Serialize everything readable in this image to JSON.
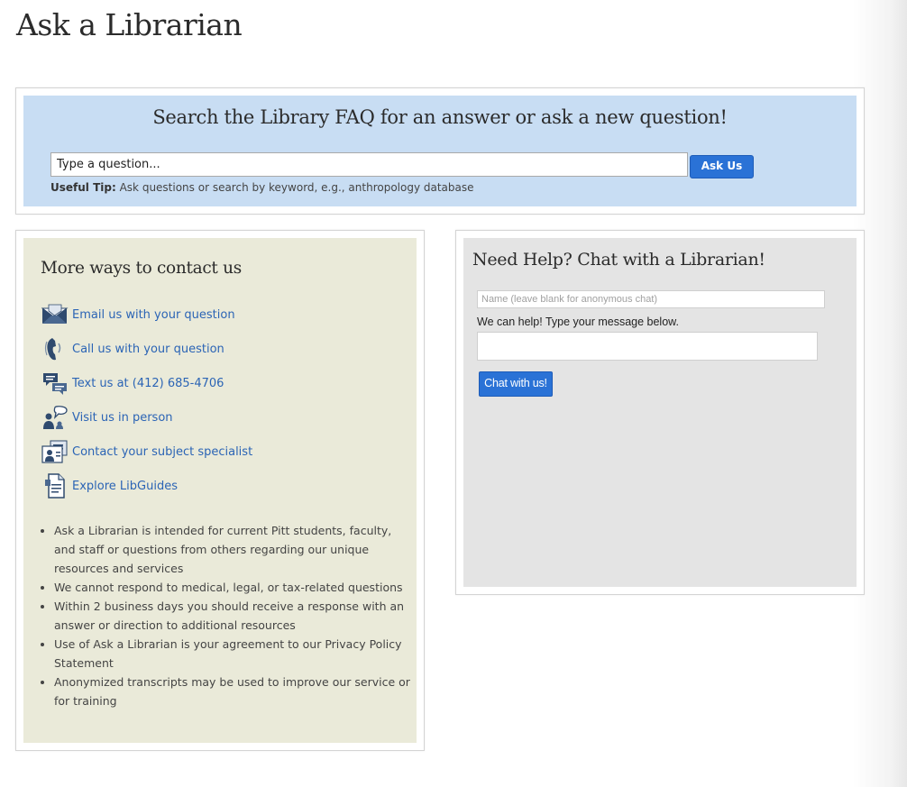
{
  "page": {
    "title": "Ask a Librarian"
  },
  "search": {
    "heading": "Search the Library FAQ for an answer or ask a new question!",
    "placeholder": "Type a question...",
    "button_label": "Ask Us",
    "tip_label": "Useful Tip:",
    "tip_text": " Ask questions or search by keyword, e.g., anthropology database"
  },
  "contact": {
    "heading": "More ways to contact us",
    "items": [
      {
        "label": "Email us with your question",
        "icon": "envelope-icon"
      },
      {
        "label": "Call us with your question",
        "icon": "phone-icon"
      },
      {
        "label": "Text us at (412) 685-4706",
        "icon": "text-message-icon"
      },
      {
        "label": "Visit us in person",
        "icon": "visit-person-icon"
      },
      {
        "label": "Contact your subject specialist",
        "icon": "subject-specialist-icon"
      },
      {
        "label": "Explore LibGuides",
        "icon": "libguides-document-icon"
      }
    ],
    "notes": [
      "Ask a Librarian is intended for current Pitt students, faculty, and staff or questions from others regarding our unique resources and services",
      "We cannot respond to medical, legal, or tax-related questions",
      "Within 2 business days you should receive a response with an answer or direction to additional resources",
      "Use of Ask a Librarian is your agreement to our Privacy Policy Statement",
      "Anonymized transcripts may be used to improve our service or for training"
    ]
  },
  "chat": {
    "heading": "Need Help? Chat with a Librarian!",
    "name_placeholder": "Name (leave blank for anonymous chat)",
    "help_text": "We can help! Type your message below.",
    "message_value": "",
    "button_label": "Chat with us!"
  },
  "colors": {
    "search_bg": "#c8ddf3",
    "contact_bg": "#eaead9",
    "chat_bg": "#e4e4e4",
    "button_blue": "#2a72d6",
    "link_blue": "#2b64b5",
    "icon_navy": "#2f4a6e"
  }
}
